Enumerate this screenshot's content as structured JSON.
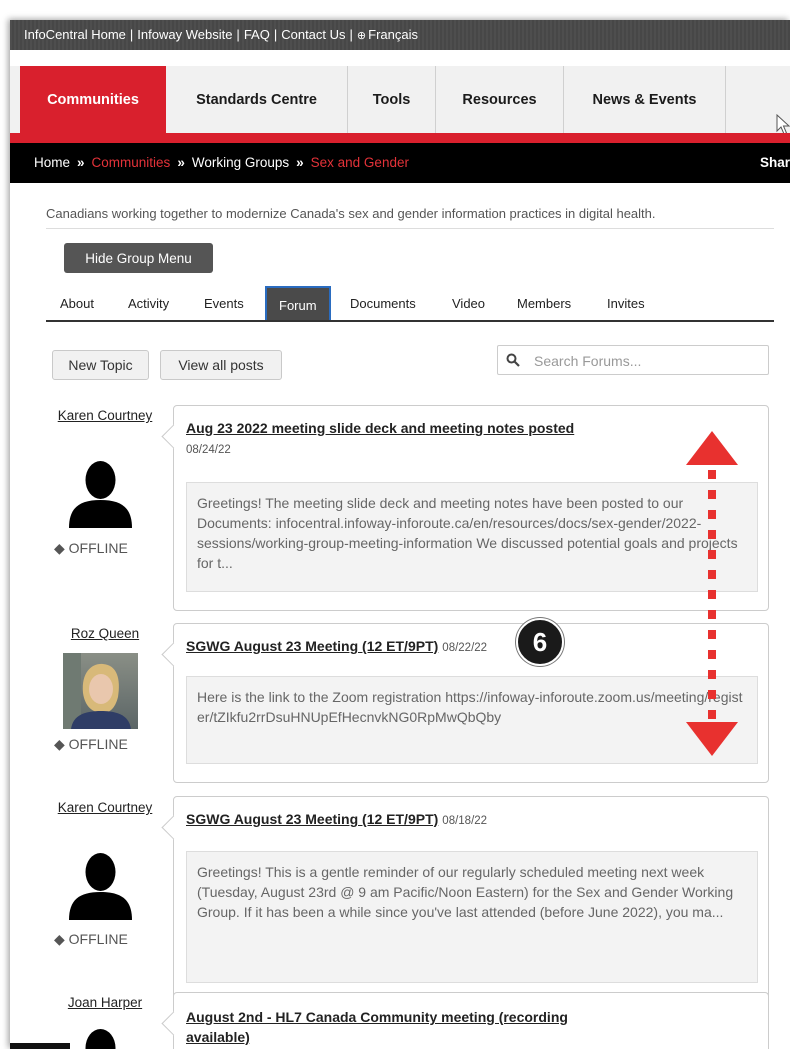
{
  "topbar": {
    "links": [
      "InfoCentral Home",
      "Infoway Website",
      "FAQ",
      "Contact Us",
      "Français"
    ],
    "separator": "|"
  },
  "nav": {
    "tabs": [
      "Communities",
      "Standards Centre",
      "Tools",
      "Resources",
      "News & Events"
    ],
    "active_tab": "Communities",
    "active_color": "#d9202d"
  },
  "breadcrumb": {
    "items": [
      "Home",
      "Communities",
      "Working Groups",
      "Sex and Gender"
    ],
    "separator": "»",
    "share_label": "Shar",
    "highlight_color": "#e33239"
  },
  "group": {
    "tagline": "Canadians working together to modernize Canada's sex and gender information practices in digital health.",
    "hide_menu_label": "Hide Group Menu",
    "tabs": [
      "About",
      "Activity",
      "Events",
      "Forum",
      "Documents",
      "Video",
      "Members",
      "Invites"
    ],
    "active_tab": "Forum"
  },
  "forum": {
    "new_topic_label": "New Topic",
    "view_all_label": "View all posts",
    "search_placeholder": "Search Forums...",
    "search_icon": "search-icon"
  },
  "posts": [
    {
      "author": "Karen Courtney",
      "avatar": "silhouette",
      "status": "OFFLINE",
      "title": "Aug 23 2022 meeting slide deck and meeting notes posted",
      "date": "08/24/22",
      "excerpt": "Greetings! The meeting slide deck and meeting notes have been posted to our Documents: infocentral.infoway-inforoute.ca/en/resources/docs/sex-gender/2022-sessions/working-group-meeting-information We discussed potential goals and projects for t..."
    },
    {
      "author": "Roz Queen",
      "avatar": "photo",
      "status": "OFFLINE",
      "title": "SGWG August 23 Meeting (12 ET/9PT)",
      "date": "08/22/22",
      "excerpt": "Here is the link to the Zoom registration https://infoway-inforoute.zoom.us/meeting/register/tZIkfu2rrDsuHNUpEfHecnvkNG0RpMwQbQby"
    },
    {
      "author": "Karen Courtney",
      "avatar": "silhouette",
      "status": "OFFLINE",
      "title": "SGWG August 23 Meeting (12 ET/9PT)",
      "date": "08/18/22",
      "excerpt": "Greetings! This is a gentle reminder of our regularly scheduled meeting next week (Tuesday, August 23rd @ 9 am Pacific/Noon Eastern) for the Sex and Gender Working Group. If it has been a while since you've last attended (before June 2022), you ma..."
    },
    {
      "author": "Joan Harper",
      "avatar": "silhouette",
      "status": "",
      "title": "August 2nd - HL7 Canada Community meeting (recording available)",
      "date": "",
      "excerpt": ""
    }
  ],
  "annotation": {
    "step_number": "6",
    "arrow_color": "#e8312f"
  }
}
